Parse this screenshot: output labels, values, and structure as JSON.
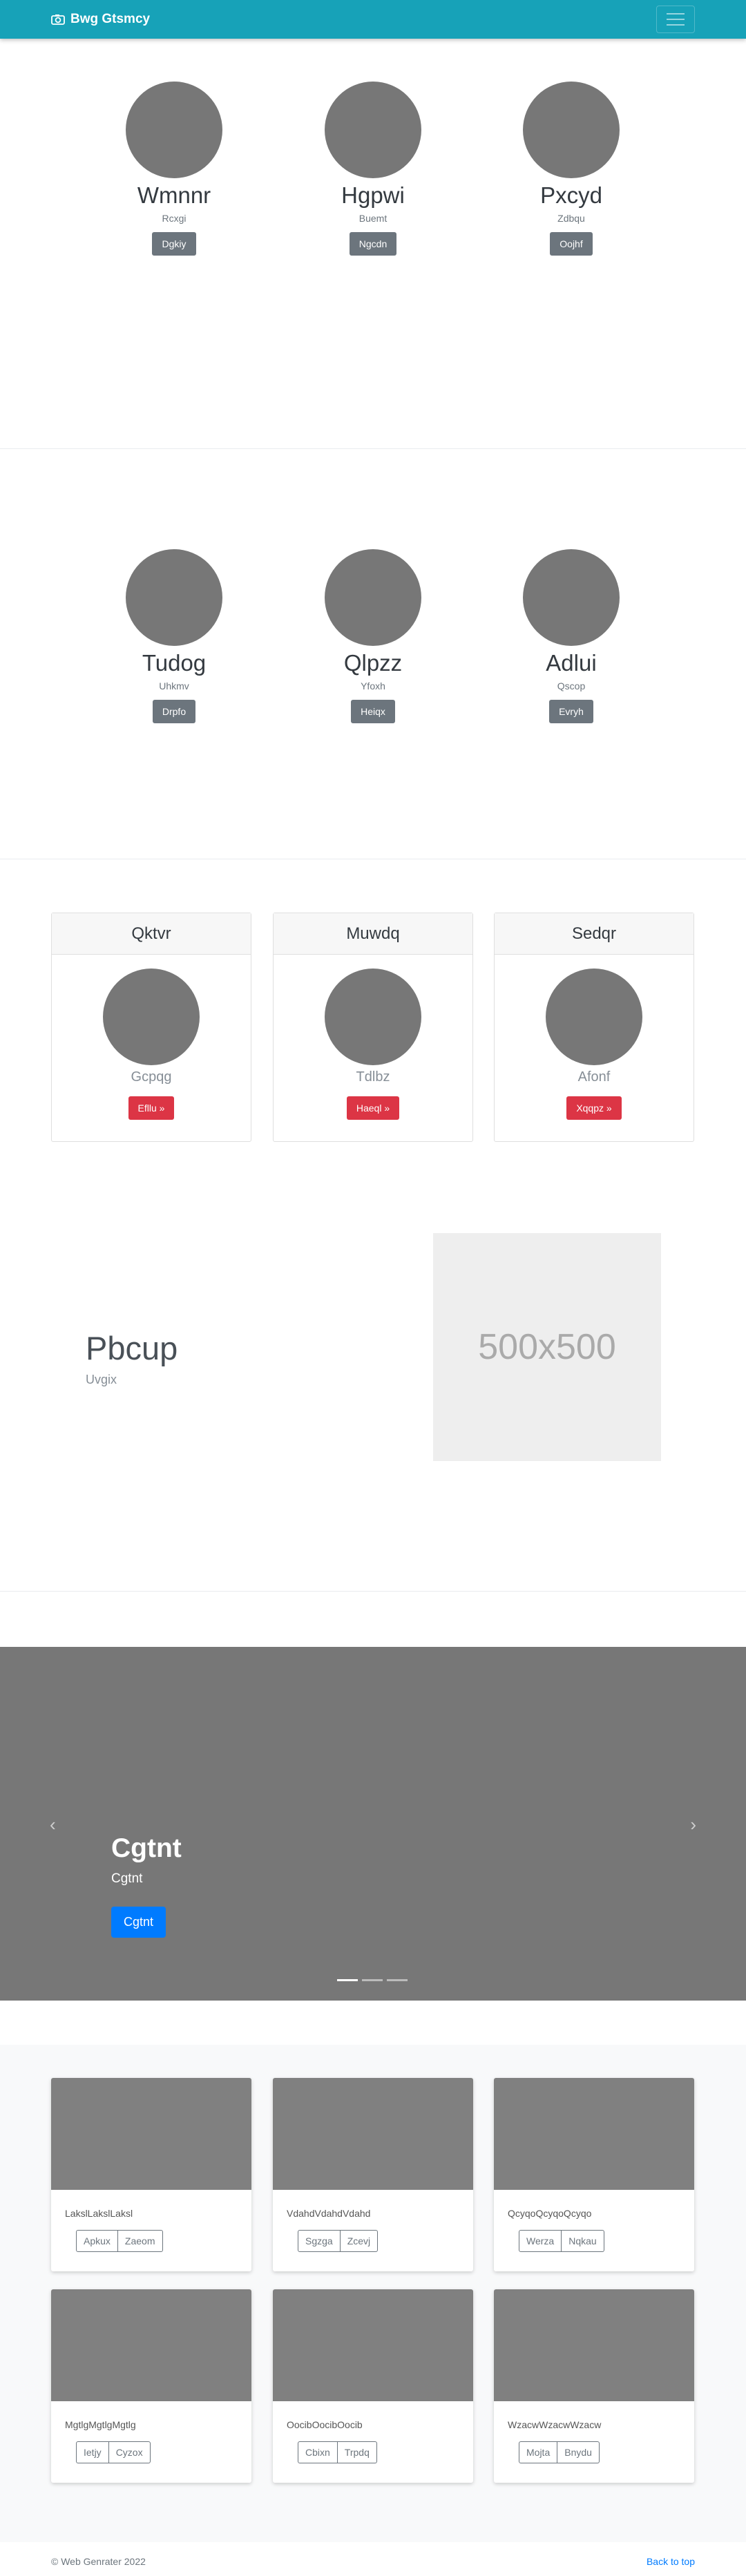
{
  "navbar": {
    "brand": "Bwg Gtsmcy",
    "brand_icon": "camera-icon",
    "toggler_icon": "hamburger-icon",
    "color": "#17a2b8"
  },
  "team_row_1": [
    {
      "name": "Wmnnr",
      "role": "Rcxgi",
      "button": "Dgkiy"
    },
    {
      "name": "Hgpwi",
      "role": "Buemt",
      "button": "Ngcdn"
    },
    {
      "name": "Pxcyd",
      "role": "Zdbqu",
      "button": "Oojhf"
    }
  ],
  "team_row_2": [
    {
      "name": "Tudog",
      "role": "Uhkmv",
      "button": "Drpfo"
    },
    {
      "name": "Qlpzz",
      "role": "Yfoxh",
      "button": "Heiqx"
    },
    {
      "name": "Adlui",
      "role": "Qscop",
      "button": "Evryh"
    }
  ],
  "header_cards": [
    {
      "header": "Qktvr",
      "subtitle": "Gcpqg",
      "button": "Efllu »"
    },
    {
      "header": "Muwdq",
      "subtitle": "Tdlbz",
      "button": "Haeql »"
    },
    {
      "header": "Sedqr",
      "subtitle": "Afonf",
      "button": "Xqqpz »"
    }
  ],
  "feature": {
    "title": "Pbcup",
    "subtitle": "Uvgix",
    "placeholder": "500x500"
  },
  "carousel": {
    "title": "Cgtnt",
    "subtitle": "Cgtnt",
    "button": "Cgtnt",
    "prev": "‹",
    "next": "›",
    "slide_count": 3,
    "active_slide": 1
  },
  "album": [
    {
      "text": "LakslLakslLaksl",
      "buttons": [
        "Apkux",
        "Zaeom"
      ]
    },
    {
      "text": "VdahdVdahdVdahd",
      "buttons": [
        "Sgzga",
        "Zcevj"
      ]
    },
    {
      "text": "QcyqoQcyqoQcyqo",
      "buttons": [
        "Werza",
        "Nqkau"
      ]
    },
    {
      "text": "MgtlgMgtlgMgtlg",
      "buttons": [
        "Ietjy",
        "Cyzox"
      ]
    },
    {
      "text": "OocibOocibOocib",
      "buttons": [
        "Cbixn",
        "Trpdq"
      ]
    },
    {
      "text": "WzacwWzacwWzacw",
      "buttons": [
        "Mojta",
        "Bnydu"
      ]
    }
  ],
  "footer": {
    "copyright": "© Web Genrater 2022",
    "back_to_top": "Back to top"
  }
}
